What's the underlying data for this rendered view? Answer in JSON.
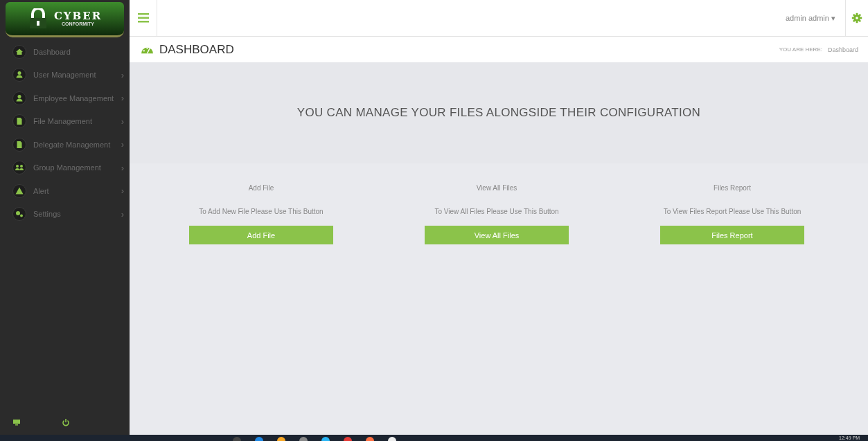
{
  "logo": {
    "title": "CYBER",
    "subtitle": "CONFORMITY"
  },
  "sidebar": {
    "items": [
      {
        "label": "Dashboard",
        "kind": "home"
      },
      {
        "label": "User Management",
        "kind": "user",
        "chevron": "›"
      },
      {
        "label": "Employee Management",
        "kind": "user",
        "chevron": "›"
      },
      {
        "label": "File Management",
        "kind": "file",
        "chevron": "›"
      },
      {
        "label": "Delegate Management",
        "kind": "file",
        "chevron": "›"
      },
      {
        "label": "Group Management",
        "kind": "group",
        "chevron": "›"
      },
      {
        "label": "Alert",
        "kind": "alert",
        "chevron": "›"
      },
      {
        "label": "Settings",
        "kind": "settings",
        "chevron": "›"
      }
    ]
  },
  "topbar": {
    "user": "admin admin",
    "caret": "▾"
  },
  "page": {
    "title": "DASHBOARD",
    "breadcrumb_label": "YOU ARE HERE:",
    "breadcrumb": "Dashboard"
  },
  "banner": "YOU CAN MANAGE YOUR FILES ALONGSIDE THEIR CONFIGURATION",
  "cards": [
    {
      "title": "Add File",
      "description": "To Add New File Please Use This Button",
      "button": "Add File"
    },
    {
      "title": "View All Files",
      "description": "To View All Files Please Use This Button",
      "button": "View All Files"
    },
    {
      "title": "Files Report",
      "description": "To View Files Report Please Use This Button",
      "button": "Files Report"
    }
  ],
  "taskbar": {
    "clock": "12:49 PM"
  }
}
